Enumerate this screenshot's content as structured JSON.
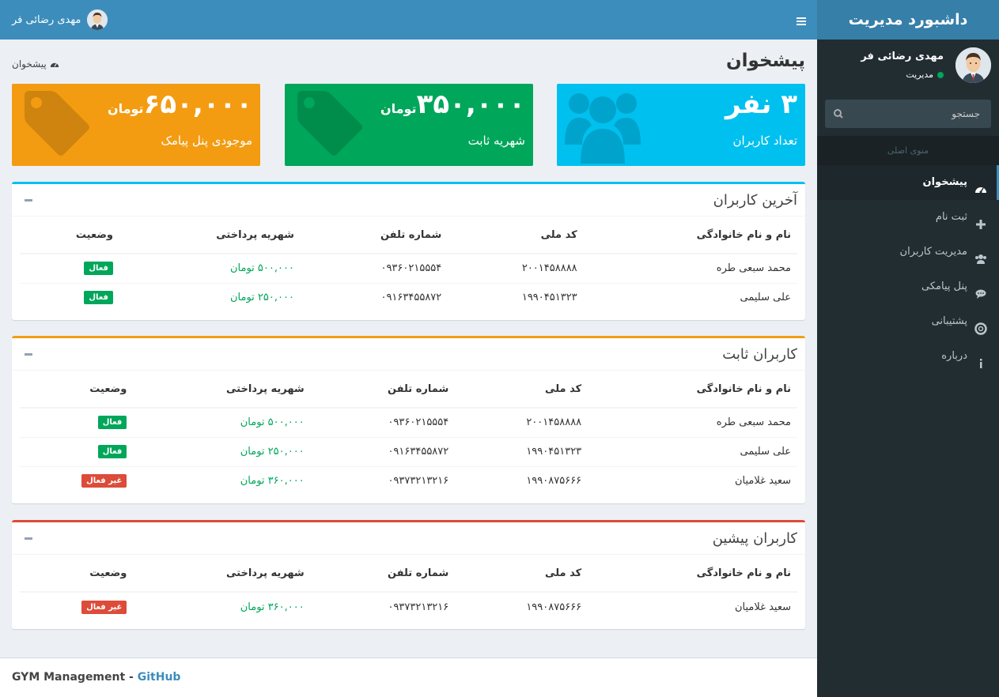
{
  "brand": "داشبورد مدیریت",
  "user": {
    "name": "مهدی رضائی فر",
    "role": "مدیریت"
  },
  "search": {
    "placeholder": "جستجو"
  },
  "menu": {
    "header": "منوی اصلی",
    "items": [
      {
        "label": "پیشخوان",
        "icon": "dashboard-icon"
      },
      {
        "label": "ثبت نام",
        "icon": "plus-icon"
      },
      {
        "label": "مدیریت کاربران",
        "icon": "users-icon"
      },
      {
        "label": "پنل پیامکی",
        "icon": "chat-icon"
      },
      {
        "label": "پشتیبانی",
        "icon": "lifebuoy-icon"
      },
      {
        "label": "درباره",
        "icon": "info-icon"
      }
    ]
  },
  "page": {
    "title": "پیشخوان",
    "breadcrumb": "پیشخوان"
  },
  "stats": [
    {
      "value": "۳ نفر",
      "unit": "",
      "label": "تعداد کاربران",
      "color": "#00c0ef",
      "icon": "users-icon"
    },
    {
      "value": "۳۵۰,۰۰۰",
      "unit": "تومان",
      "label": "شهریه ثابت",
      "color": "#00a65a",
      "icon": "tag-icon"
    },
    {
      "value": "۶۵۰,۰۰۰",
      "unit": "تومان",
      "label": "موجودی پنل پیامک",
      "color": "#f39c12",
      "icon": "tag-icon"
    }
  ],
  "columns": [
    "نام و نام خانوادگی",
    "کد ملی",
    "شماره تلفن",
    "شهریه پرداختی",
    "وضعیت"
  ],
  "tables": [
    {
      "title": "آخرین کاربران",
      "color": "#00c0ef",
      "rows": [
        {
          "name": "محمد سبعی طره",
          "nid": "۲۰۰۱۴۵۸۸۸۸",
          "phone": "۰۹۳۶۰۲۱۵۵۵۴",
          "fee": "۵۰۰,۰۰۰ تومان",
          "status": "فعال"
        },
        {
          "name": "علی سلیمی",
          "nid": "۱۹۹۰۴۵۱۳۲۳",
          "phone": "۰۹۱۶۳۴۵۵۸۷۲",
          "fee": "۲۵۰,۰۰۰ تومان",
          "status": "فعال"
        }
      ]
    },
    {
      "title": "کاربران ثابت",
      "color": "#f39c12",
      "rows": [
        {
          "name": "محمد سبعی طره",
          "nid": "۲۰۰۱۴۵۸۸۸۸",
          "phone": "۰۹۳۶۰۲۱۵۵۵۴",
          "fee": "۵۰۰,۰۰۰ تومان",
          "status": "فعال"
        },
        {
          "name": "علی سلیمی",
          "nid": "۱۹۹۰۴۵۱۳۲۳",
          "phone": "۰۹۱۶۳۴۵۵۸۷۲",
          "fee": "۲۵۰,۰۰۰ تومان",
          "status": "فعال"
        },
        {
          "name": "سعید غلامیان",
          "nid": "۱۹۹۰۸۷۵۶۶۶",
          "phone": "۰۹۳۷۳۲۱۳۲۱۶",
          "fee": "۳۶۰,۰۰۰ تومان",
          "status": "غیر فعال"
        }
      ]
    },
    {
      "title": "کاربران پیشین",
      "color": "#dd4b39",
      "rows": [
        {
          "name": "سعید غلامیان",
          "nid": "۱۹۹۰۸۷۵۶۶۶",
          "phone": "۰۹۳۷۳۲۱۳۲۱۶",
          "fee": "۳۶۰,۰۰۰ تومان",
          "status": "غیر فعال"
        }
      ]
    }
  ],
  "footer": {
    "text": "GYM Management - ",
    "link": "GitHub"
  }
}
